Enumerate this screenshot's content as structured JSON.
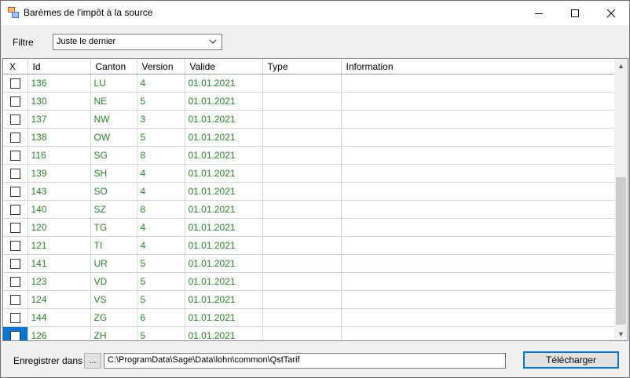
{
  "window": {
    "title": "Barèmes de l'impôt à la source"
  },
  "filter": {
    "label": "Filtre",
    "selected": "Juste le dernier"
  },
  "grid": {
    "columns": [
      "X",
      "Id",
      "Canton",
      "Version",
      "Valide",
      "Type",
      "Information"
    ],
    "rows": [
      {
        "id": "136",
        "canton": "LU",
        "version": "4",
        "valide": "01.01.2021",
        "type": "",
        "info": ""
      },
      {
        "id": "130",
        "canton": "NE",
        "version": "5",
        "valide": "01.01.2021",
        "type": "",
        "info": ""
      },
      {
        "id": "137",
        "canton": "NW",
        "version": "3",
        "valide": "01.01.2021",
        "type": "",
        "info": ""
      },
      {
        "id": "138",
        "canton": "OW",
        "version": "5",
        "valide": "01.01.2021",
        "type": "",
        "info": ""
      },
      {
        "id": "116",
        "canton": "SG",
        "version": "8",
        "valide": "01.01.2021",
        "type": "",
        "info": ""
      },
      {
        "id": "139",
        "canton": "SH",
        "version": "4",
        "valide": "01.01.2021",
        "type": "",
        "info": ""
      },
      {
        "id": "143",
        "canton": "SO",
        "version": "4",
        "valide": "01.01.2021",
        "type": "",
        "info": ""
      },
      {
        "id": "140",
        "canton": "SZ",
        "version": "8",
        "valide": "01.01.2021",
        "type": "",
        "info": ""
      },
      {
        "id": "120",
        "canton": "TG",
        "version": "4",
        "valide": "01.01.2021",
        "type": "",
        "info": ""
      },
      {
        "id": "121",
        "canton": "TI",
        "version": "4",
        "valide": "01.01.2021",
        "type": "",
        "info": ""
      },
      {
        "id": "141",
        "canton": "UR",
        "version": "5",
        "valide": "01.01.2021",
        "type": "",
        "info": ""
      },
      {
        "id": "123",
        "canton": "VD",
        "version": "5",
        "valide": "01.01.2021",
        "type": "",
        "info": ""
      },
      {
        "id": "124",
        "canton": "VS",
        "version": "5",
        "valide": "01.01.2021",
        "type": "",
        "info": ""
      },
      {
        "id": "144",
        "canton": "ZG",
        "version": "6",
        "valide": "01.01.2021",
        "type": "",
        "info": ""
      },
      {
        "id": "126",
        "canton": "ZH",
        "version": "5",
        "valide": "01.01.2021",
        "type": "",
        "info": "",
        "selected": true
      }
    ]
  },
  "footer": {
    "save_label": "Enregistrer dans",
    "browse_label": "...",
    "path": "C:\\ProgramData\\Sage\\Data\\lohn\\common\\QstTarif",
    "download_label": "Télécharger"
  },
  "colors": {
    "row_text": "#228b22",
    "selection": "#0078d7",
    "grid_border": "#d8d8d8"
  }
}
